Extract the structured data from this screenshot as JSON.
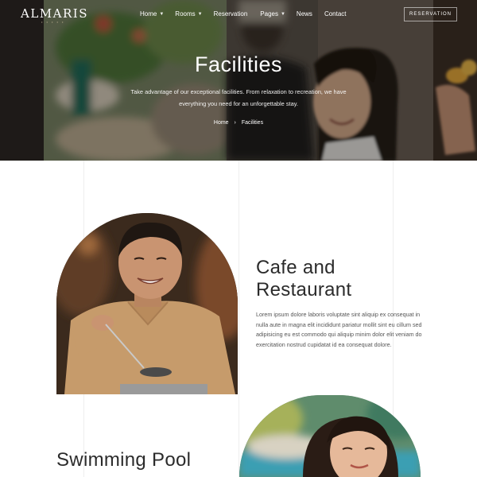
{
  "brand": {
    "name": "ALMARIS",
    "sub": "• • • • •"
  },
  "nav": {
    "items": [
      {
        "label": "Home",
        "dropdown": true
      },
      {
        "label": "Rooms",
        "dropdown": true
      },
      {
        "label": "Reservation",
        "dropdown": false
      },
      {
        "label": "Pages",
        "dropdown": true
      },
      {
        "label": "News",
        "dropdown": false
      },
      {
        "label": "Contact",
        "dropdown": false
      }
    ],
    "cta_label": "RESERVATION"
  },
  "hero": {
    "title": "Facilities",
    "description": "Take advantage of our exceptional facilities. From relaxation to recreation, we have everything you need for an unforgettable stay.",
    "breadcrumb": {
      "home": "Home",
      "separator": "›",
      "current": "Facilities"
    }
  },
  "sections": {
    "cafe": {
      "title": "Cafe and Restaurant",
      "text": "Lorem ipsum dolore laboris voluptate sint aliquip ex consequat in nulla aute in magna elit incididunt pariatur mollit sint eu cillum sed adipisicing eu est commodo qui aliquip minim dolor elit veniam do exercitation nostrud cupidatat id ea consequat dolore."
    },
    "pool": {
      "title": "Swimming Pool"
    }
  },
  "colors": {
    "accent": "#d9c9a8",
    "heading": "#2b2b2b",
    "body_text": "#555555"
  }
}
